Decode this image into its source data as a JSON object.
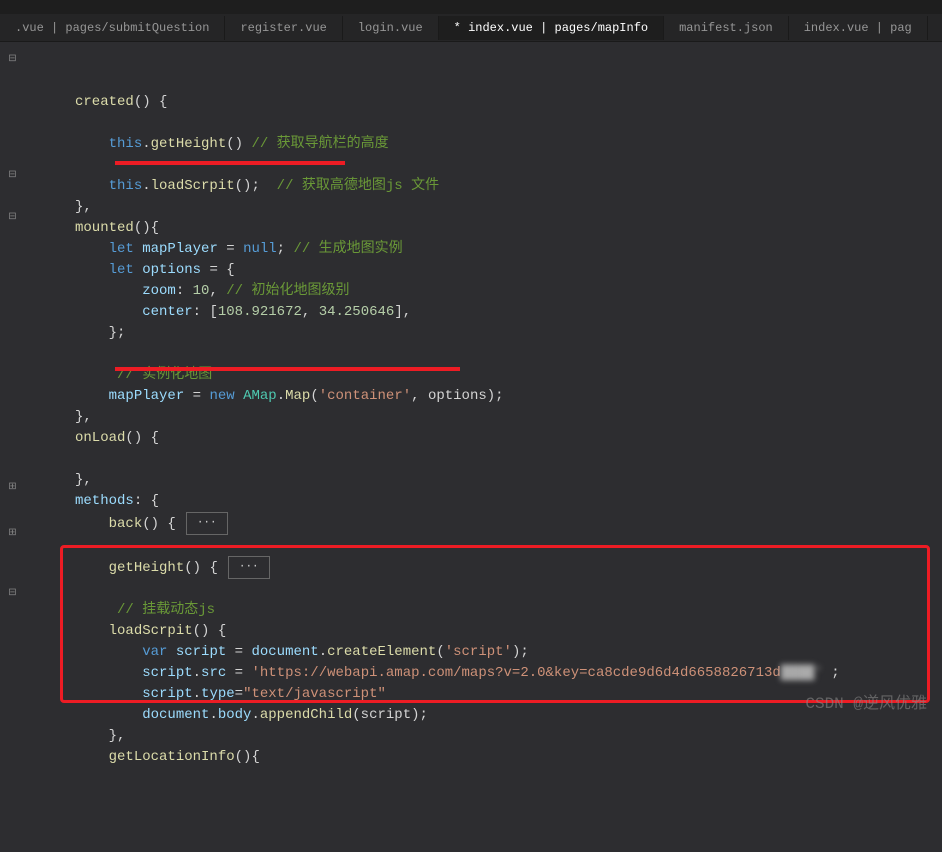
{
  "tabs": [
    {
      "label": ".vue | pages/submitQuestion",
      "active": false
    },
    {
      "label": "register.vue",
      "active": false
    },
    {
      "label": "login.vue",
      "active": false
    },
    {
      "label": "* index.vue | pages/mapInfo",
      "active": true
    },
    {
      "label": "manifest.json",
      "active": false
    },
    {
      "label": "index.vue | pag",
      "active": false
    }
  ],
  "code": {
    "c1_a": "created",
    "c1_b": "() {",
    "c2_a": "this",
    "c2_b": ".",
    "c2_c": "getHeight",
    "c2_d": "()",
    "c2_e": " // 获取导航栏的高度",
    "c3_a": "this",
    "c3_b": ".",
    "c3_c": "loadScrpit",
    "c3_d": "();",
    "c3_e": "  // 获取高德地图js 文件",
    "c4": "},",
    "c5_a": "mounted",
    "c5_b": "(){",
    "c6_a": "let",
    "c6_b": " mapPlayer",
    "c6_c": " = ",
    "c6_d": "null",
    "c6_e": ";",
    "c6_f": " // 生成地图实例",
    "c7_a": "let",
    "c7_b": " options",
    "c7_c": " = {",
    "c8_a": "zoom",
    "c8_b": ": ",
    "c8_c": "10",
    "c8_d": ",",
    "c8_e": " // 初始化地图级别",
    "c9_a": "center",
    "c9_b": ": [",
    "c9_c": "108.921672",
    "c9_d": ", ",
    "c9_e": "34.250646",
    "c9_f": "],",
    "c10": "};",
    "c11": " // 实例化地图",
    "c12_a": "mapPlayer",
    "c12_b": " = ",
    "c12_c": "new",
    "c12_d": " AMap",
    "c12_e": ".",
    "c12_f": "Map",
    "c12_g": "(",
    "c12_h": "'container'",
    "c12_i": ", options);",
    "c13": "},",
    "c14_a": "onLoad",
    "c14_b": "() {",
    "c15": "},",
    "c16_a": "methods",
    "c16_b": ": {",
    "c17_a": "back",
    "c17_b": "() {",
    "c17_fold": "···",
    "c18_a": "getHeight",
    "c18_b": "() {",
    "c18_fold": "···",
    "c19": " // 挂载动态js",
    "c20_a": "loadScrpit",
    "c20_b": "() {",
    "c21_a": "var",
    "c21_b": " script",
    "c21_c": " = ",
    "c21_d": "document",
    "c21_e": ".",
    "c21_f": "createElement",
    "c21_g": "(",
    "c21_h": "'script'",
    "c21_i": ");",
    "c22_a": "script",
    "c22_b": ".",
    "c22_c": "src",
    "c22_d": " = ",
    "c22_e": "'https://webapi.amap.com/maps?v=2.0&key=ca8cde9d6d4d6658826713d",
    "c22_f": " ;",
    "c23_a": "script",
    "c23_b": ".",
    "c23_c": "type",
    "c23_d": "=",
    "c23_e": "\"text/javascript\"",
    "c24_a": "document",
    "c24_b": ".",
    "c24_c": "body",
    "c24_d": ".",
    "c24_e": "appendChild",
    "c24_f": "(script);",
    "c25": "},",
    "c26_a": "getLocationInfo",
    "c26_b": "(){"
  },
  "watermark": "CSDN @逆风优雅"
}
